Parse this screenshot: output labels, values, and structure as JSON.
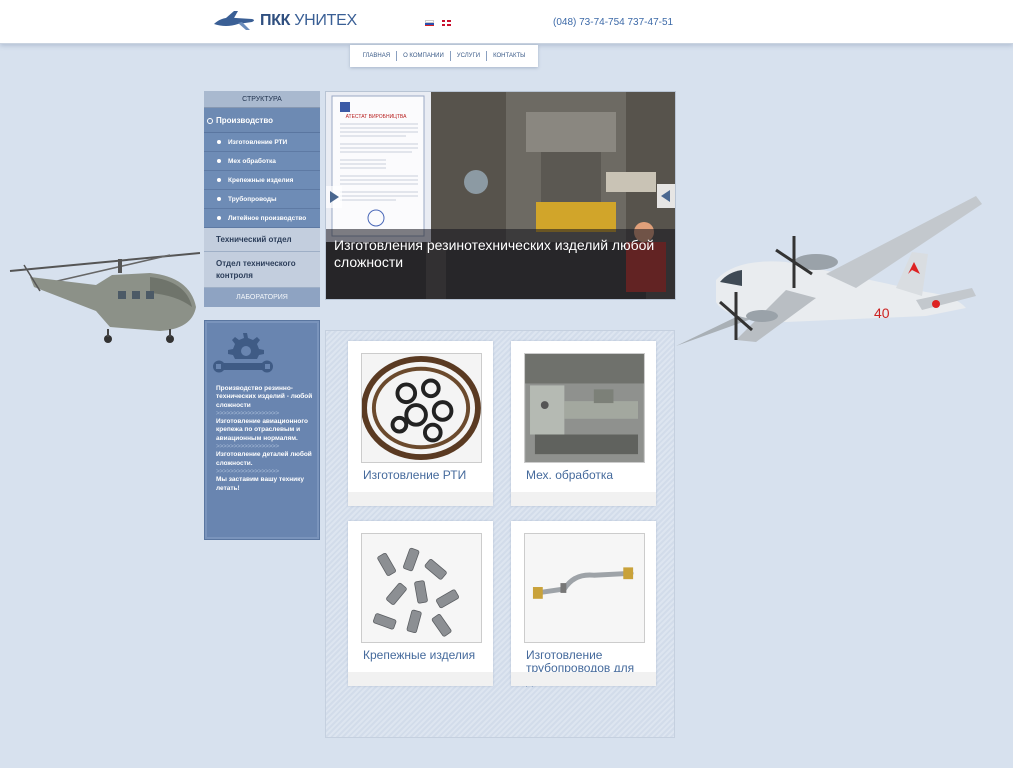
{
  "header": {
    "logo_bold": "ПКК",
    "logo_thin": "УНИТЕХ",
    "phones": "(048) 73-74-754 737-47-51",
    "languages": [
      "ru",
      "en"
    ]
  },
  "topnav": {
    "items": [
      "главная",
      "о компании",
      "услуги",
      "контакты"
    ]
  },
  "sidebar": {
    "head": "Структура",
    "main": "Производство",
    "subs": [
      "Изготовление РТИ",
      "Мех обработка",
      "Крепежные изделия",
      "Трубопроводы",
      "Литейное производство"
    ],
    "item1": "Технический отдел",
    "item2": "Отдел технического контроля",
    "lab": "Лаборатория"
  },
  "info": {
    "p1": "Производство резинно-технических изделий - любой сложности",
    "sep": ">>>>>>>>>>>>>>>>>>",
    "p2": "Изготовление авиационного крепежа по отраслевым и авиационным нормалям.",
    "p3": "Изготовление деталей любой сложности.",
    "p4": "Мы заставим вашу технику летать!"
  },
  "slider": {
    "caption": "Изготовления резинотехнических изделий любой сложности",
    "doc_title": "АТЕСТАТ ВИРОБНИЦТВА"
  },
  "products": [
    {
      "label": "Изготовление РТИ"
    },
    {
      "label": "Мех. обработка"
    },
    {
      "label": "Крепежные изделия"
    },
    {
      "label": "Изготовление трубопроводов для двигателей"
    }
  ],
  "aircraft": {
    "tail_number": "40"
  },
  "colors": {
    "background": "#d7e1ee",
    "accent": "#3d6aa8",
    "sidebar_active": "#6d8ab3"
  }
}
